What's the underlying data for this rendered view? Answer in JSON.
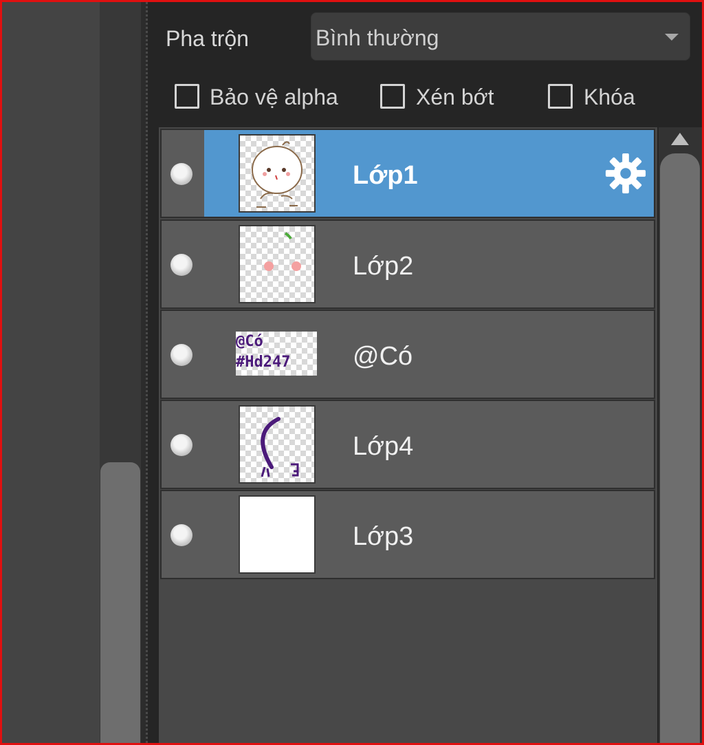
{
  "blend": {
    "label": "Pha trộn",
    "value": "Bình thường"
  },
  "options": {
    "protect_alpha": {
      "label": "Bảo vệ alpha",
      "checked": false
    },
    "clipping": {
      "label": "Xén bớt",
      "checked": false
    },
    "lock": {
      "label": "Khóa",
      "checked": false
    }
  },
  "layers": [
    {
      "name": "Lớp1",
      "selected": true,
      "thumbnail": "chibi-sketch",
      "settings_icon": "gear-icon"
    },
    {
      "name": "Lớp2",
      "selected": false,
      "thumbnail": "blush-dots"
    },
    {
      "name": "@Có",
      "selected": false,
      "thumbnail": "text-watermark",
      "thumbnail_text": "@Có\n#Hd247"
    },
    {
      "name": "Lớp4",
      "selected": false,
      "thumbnail": "purple-stroke"
    },
    {
      "name": "Lớp3",
      "selected": false,
      "thumbnail": "white-fill"
    }
  ],
  "colors": {
    "selected_row": "#5297cf",
    "row": "#5b5b5b",
    "panel_bg": "#252525",
    "text": "#d9d9d9",
    "watermark_text": "#4b1a7a",
    "frame": "#e01010"
  }
}
